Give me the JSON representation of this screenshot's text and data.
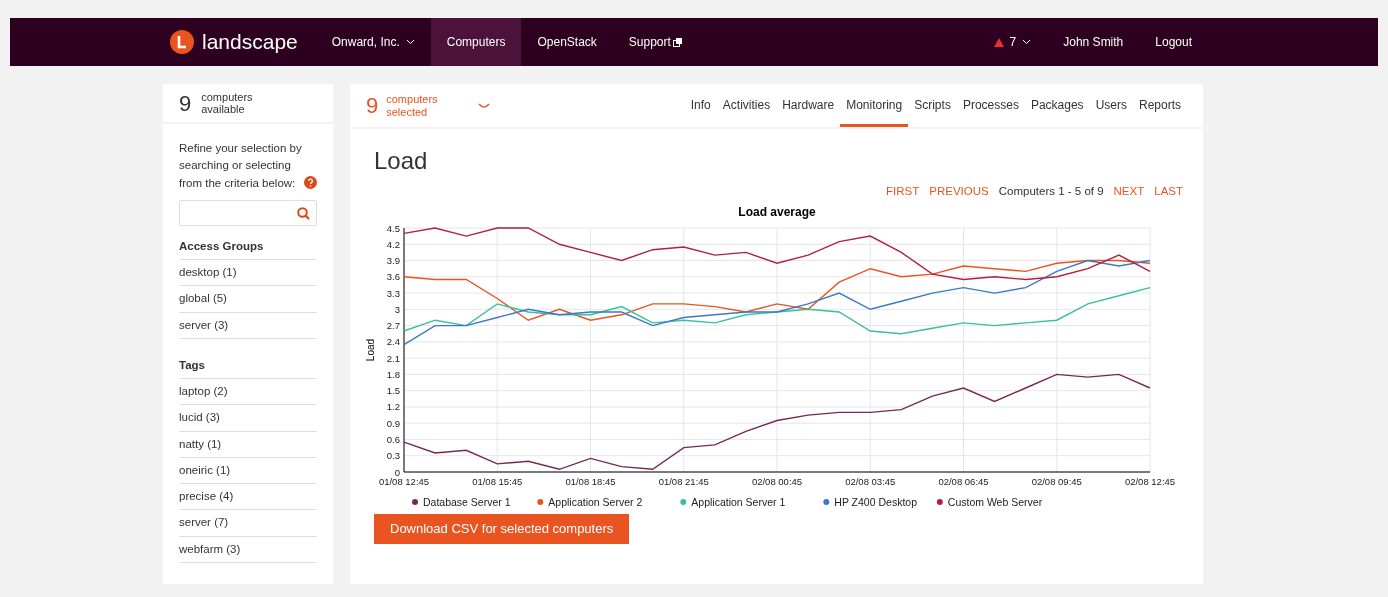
{
  "navbar": {
    "brand": "landscape",
    "items": [
      {
        "label": "Onward, Inc.",
        "dropdown": true,
        "selected": false
      },
      {
        "label": "Computers",
        "dropdown": false,
        "selected": true
      },
      {
        "label": "OpenStack",
        "dropdown": false,
        "selected": false
      },
      {
        "label": "Support",
        "dropdown": false,
        "external": true,
        "selected": false
      }
    ],
    "alerts": "7",
    "user": "John Smith",
    "logout": "Logout"
  },
  "sidebar": {
    "count": "9",
    "count_label": "computers available",
    "intro": "Refine your selection by searching or selecting from the criteria below:",
    "sections": [
      {
        "title": "Access Groups",
        "items": [
          "desktop (1)",
          "global (5)",
          "server (3)"
        ]
      },
      {
        "title": "Tags",
        "items": [
          "laptop (2)",
          "lucid (3)",
          "natty (1)",
          "oneiric (1)",
          "precise (4)",
          "server (7)",
          "webfarm (3)"
        ]
      }
    ]
  },
  "selection": {
    "count": "9",
    "count_label": "computers selected"
  },
  "tabs": [
    {
      "label": "Info",
      "selected": false
    },
    {
      "label": "Activities",
      "selected": false
    },
    {
      "label": "Hardware",
      "selected": false
    },
    {
      "label": "Monitoring",
      "selected": true
    },
    {
      "label": "Scripts",
      "selected": false
    },
    {
      "label": "Processes",
      "selected": false
    },
    {
      "label": "Packages",
      "selected": false
    },
    {
      "label": "Users",
      "selected": false
    },
    {
      "label": "Reports",
      "selected": false
    }
  ],
  "heading": "Load",
  "pager": {
    "first": "FIRST",
    "previous": "PREVIOUS",
    "range": "Computers 1 - 5 of 9",
    "next": "NEXT",
    "last": "LAST"
  },
  "chart": {
    "chart_data": {
      "type": "line",
      "title": "Load average",
      "ylabel": "Load",
      "categories": [
        "01/08 12:45",
        null,
        null,
        "01/08 15:45",
        null,
        null,
        "01/08 18:45",
        null,
        null,
        "01/08 21:45",
        null,
        null,
        "02/08 00:45",
        null,
        null,
        "02/08 03:45",
        null,
        null,
        "02/08 06:45",
        null,
        null,
        "02/08 09:45",
        null,
        null,
        "02/08 12:45"
      ],
      "ylim": [
        0,
        4.5
      ],
      "grid": true,
      "legend": "bottom",
      "yticks": [
        {
          "value": 0,
          "label": "0"
        },
        {
          "value": 0.3,
          "label": "0.3"
        },
        {
          "value": 0.6,
          "label": "0.6"
        },
        {
          "value": 0.9,
          "label": "0.9"
        },
        {
          "value": 1.2,
          "label": "1.2"
        },
        {
          "value": 1.5,
          "label": "1.5"
        },
        {
          "value": 1.8,
          "label": "1.8"
        },
        {
          "value": 2.1,
          "label": "2.1"
        },
        {
          "value": 2.4,
          "label": "2.4"
        },
        {
          "value": 2.7,
          "label": "2.7"
        },
        {
          "value": 3,
          "label": "3"
        },
        {
          "value": 3.3,
          "label": "3.3"
        },
        {
          "value": 3.6,
          "label": "3.6"
        },
        {
          "value": 3.9,
          "label": "3.9"
        },
        {
          "value": 4.2,
          "label": "4.2"
        },
        {
          "value": 4.5,
          "label": "4.5"
        }
      ],
      "series": [
        {
          "name": "Database Server 1",
          "color": "#772953",
          "values": [
            0.55,
            0.35,
            0.4,
            0.15,
            0.2,
            0.05,
            0.25,
            0.1,
            0.05,
            0.45,
            0.5,
            0.75,
            0.95,
            1.05,
            1.1,
            1.1,
            1.15,
            1.4,
            1.55,
            1.3,
            1.55,
            1.8,
            1.75,
            1.8,
            1.55
          ]
        },
        {
          "name": "Application Server 2",
          "color": "#e95420",
          "values": [
            3.6,
            3.55,
            3.55,
            3.2,
            2.8,
            3.0,
            2.8,
            2.9,
            3.1,
            3.1,
            3.05,
            2.95,
            3.1,
            3.0,
            3.5,
            3.75,
            3.6,
            3.65,
            3.8,
            3.75,
            3.7,
            3.85,
            3.9,
            3.9,
            3.85
          ]
        },
        {
          "name": "Application Server 1",
          "color": "#38c09c",
          "values": [
            2.6,
            2.8,
            2.7,
            3.1,
            2.95,
            2.9,
            2.9,
            3.05,
            2.75,
            2.8,
            2.75,
            2.9,
            2.95,
            3.0,
            2.95,
            2.6,
            2.55,
            2.65,
            2.75,
            2.7,
            2.75,
            2.8,
            3.1,
            3.25,
            3.4
          ]
        },
        {
          "name": "HP Z400 Desktop",
          "color": "#3b78c8",
          "values": [
            2.35,
            2.7,
            2.7,
            2.85,
            3.0,
            2.9,
            2.95,
            2.95,
            2.7,
            2.85,
            2.9,
            2.95,
            2.95,
            3.1,
            3.3,
            3.0,
            3.15,
            3.3,
            3.4,
            3.3,
            3.4,
            3.7,
            3.9,
            3.8,
            3.9
          ]
        },
        {
          "name": "Custom Web Server",
          "color": "#b0213b",
          "values": [
            4.4,
            4.5,
            4.35,
            4.5,
            4.5,
            4.2,
            4.05,
            3.9,
            4.1,
            4.15,
            4.0,
            4.05,
            3.85,
            4.0,
            4.25,
            4.35,
            4.05,
            3.65,
            3.55,
            3.6,
            3.55,
            3.6,
            3.75,
            4.0,
            3.7
          ]
        }
      ]
    }
  },
  "download": "Download CSV for selected computers"
}
